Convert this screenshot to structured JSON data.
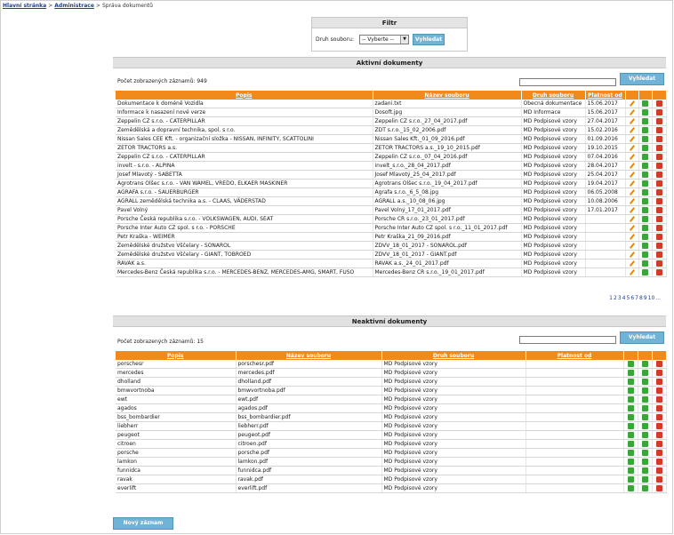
{
  "breadcrumb": {
    "home": "Hlavní stránka",
    "admin": "Administrace",
    "current": "Správa dokumentů",
    "sep": ">"
  },
  "filter": {
    "title": "Filtr",
    "label": "Druh souboru:",
    "select_value": "-- Vyberte --",
    "button": "Vyhledat"
  },
  "active": {
    "title": "Aktivní dokumenty",
    "count_label": "Počet zobrazených záznamů: 949",
    "search_button": "Vyhledat",
    "headers": [
      "Popis",
      "Název souboru",
      "Druh souboru",
      "Platnost od"
    ],
    "rows": [
      [
        "Dokumentace k doméně Vozidla",
        "zadani.txt",
        "Obecná dokumentace",
        "15.06.2017"
      ],
      [
        "Informace k nasazení nové verze",
        "Dosoft.jpg",
        "MD Informace",
        "15.06.2017"
      ],
      [
        "Zeppelin CZ s.r.o. - CATERPILLAR",
        "Zeppelin CZ s.r.o._27_04_2017.pdf",
        "MD Podpisové vzory",
        "27.04.2017"
      ],
      [
        "Zemědělská a dopravní technika, spol. s r.o.",
        "ZDT s.r.o._15_02_2006.pdf",
        "MD Podpisové vzory",
        "15.02.2016"
      ],
      [
        "Nissan Sales CEE Kft. - organizační složka - NISSAN, INFINITY, SCATTOLINI",
        "Nissan Sales Kft._01_09_2016.pdf",
        "MD Podpisové vzory",
        "01.09.2016"
      ],
      [
        "ZETOR TRACTORS a.s.",
        "ZETOR TRACTORS a.s._19_10_2015.pdf",
        "MD Podpisové vzory",
        "19.10.2015"
      ],
      [
        "Zeppelin CZ s.r.o. - CATERPILLAR",
        "Zeppelin CZ s.r.o._07_04_2016.pdf",
        "MD Podpisové vzory",
        "07.04.2016"
      ],
      [
        "invelt - s.r.o. - ALPINA",
        "invelt_s.r.o._28_04_2017.pdf",
        "MD Podpisové vzory",
        "28.04.2017"
      ],
      [
        "Josef Mlavotý - SABETTA",
        "Josef Mlavotý_25_04_2017.pdf",
        "MD Podpisové vzory",
        "25.04.2017"
      ],
      [
        "Agrotrans Olšec s.r.o. - VAN WAMEL, VREDO, ELKAER MASKINER",
        "Agrotrans Olšec s.r.o._19_04_2017.pdf",
        "MD Podpisové vzory",
        "19.04.2017"
      ],
      [
        "AGRAFA s.r.o. - SAUERBURGER",
        "Agrafa s.r.o._6_5_08.jpg",
        "MD Podpisové vzory",
        "06.05.2008"
      ],
      [
        "AGRALL zemědělská technika a.s. - CLAAS, VÄDERSTAD",
        "AGRALL a.s._10_08_06.jpg",
        "MD Podpisové vzory",
        "10.08.2006"
      ],
      [
        "Pavel Volný",
        "Pavel Volný_17_01_2017.pdf",
        "MD Podpisové vzory",
        "17.01.2017"
      ],
      [
        "Porsche Česká republika s.r.o. - VOLKSWAGEN, AUDI, SEAT",
        "Porsche CR s.r.o._23_01_2017.pdf",
        "MD Podpisové vzory",
        ""
      ],
      [
        "Porsche Inter Auto CZ spol. s r.o. - PORSCHE",
        "Porsche Inter Auto CZ spol. s r.o._11_01_2017.pdf",
        "MD Podpisové vzory",
        ""
      ],
      [
        "Petr Kraška - WEIMER",
        "Petr Kraška_21_09_2016.pdf",
        "MD Podpisové vzory",
        ""
      ],
      [
        "Zemědělské družstvo Vščelary - SONAROL",
        "ZDVV_18_01_2017 - SONAROL.pdf",
        "MD Podpisové vzory",
        ""
      ],
      [
        "Zemědělské družstvo Vščelary - GIANT, TOBROED",
        "ZDVV_18_01_2017 - GIANT.pdf",
        "MD Podpisové vzory",
        ""
      ],
      [
        "RAVAK a.s.",
        "RAVAK a.s._24_01_2017.pdf",
        "MD Podpisové vzory",
        ""
      ],
      [
        "Mercedes-Benz Česká republika s.r.o. - MERCEDES-BENZ, MERCEDES-AMG, SMART, FUSO",
        "Mercedes-Benz CR s.r.o._19_01_2017.pdf",
        "MD Podpisové vzory",
        ""
      ]
    ],
    "pager": [
      "1",
      "2",
      "3",
      "4",
      "5",
      "6",
      "7",
      "8",
      "9",
      "10",
      "..."
    ]
  },
  "inactive": {
    "title": "Neaktivní dokumenty",
    "count_label": "Počet zobrazených záznamů: 15",
    "search_button": "Vyhledat",
    "headers": [
      "Popis",
      "Název souboru",
      "Druh souboru",
      "Platnost od"
    ],
    "rows": [
      [
        "porschesr",
        "porschesr.pdf",
        "MD Podpisové vzory",
        ""
      ],
      [
        "mercedes",
        "mercedes.pdf",
        "MD Podpisové vzory",
        ""
      ],
      [
        "dholland",
        "dholland.pdf",
        "MD Podpisové vzory",
        ""
      ],
      [
        "bmwvortnoba",
        "bmwvortnoba.pdf",
        "MD Podpisové vzory",
        ""
      ],
      [
        "ewt",
        "ewt.pdf",
        "MD Podpisové vzory",
        ""
      ],
      [
        "agados",
        "agados.pdf",
        "MD Podpisové vzory",
        ""
      ],
      [
        "bss_bombardier",
        "bss_bombardier.pdf",
        "MD Podpisové vzory",
        ""
      ],
      [
        "liebherr",
        "liebherr.pdf",
        "MD Podpisové vzory",
        ""
      ],
      [
        "peugeot",
        "peugeot.pdf",
        "MD Podpisové vzory",
        ""
      ],
      [
        "citroen",
        "citroen.pdf",
        "MD Podpisové vzory",
        ""
      ],
      [
        "porsche",
        "porsche.pdf",
        "MD Podpisové vzory",
        ""
      ],
      [
        "lamkon",
        "lamkon.pdf",
        "MD Podpisové vzory",
        ""
      ],
      [
        "funnidca",
        "funnidca.pdf",
        "MD Podpisové vzory",
        ""
      ],
      [
        "ravak",
        "ravak.pdf",
        "MD Podpisové vzory",
        ""
      ],
      [
        "everlift",
        "everlift.pdf",
        "MD Podpisové vzory",
        ""
      ]
    ]
  },
  "new_button": "Nový záznam",
  "icons": {
    "edit": "pencil-icon",
    "download": "download-icon",
    "delete": "delete-icon"
  },
  "colors": {
    "header_orange": "#f08a1a",
    "button_blue": "#6fb3d6",
    "link_blue": "#1d3f8c"
  }
}
